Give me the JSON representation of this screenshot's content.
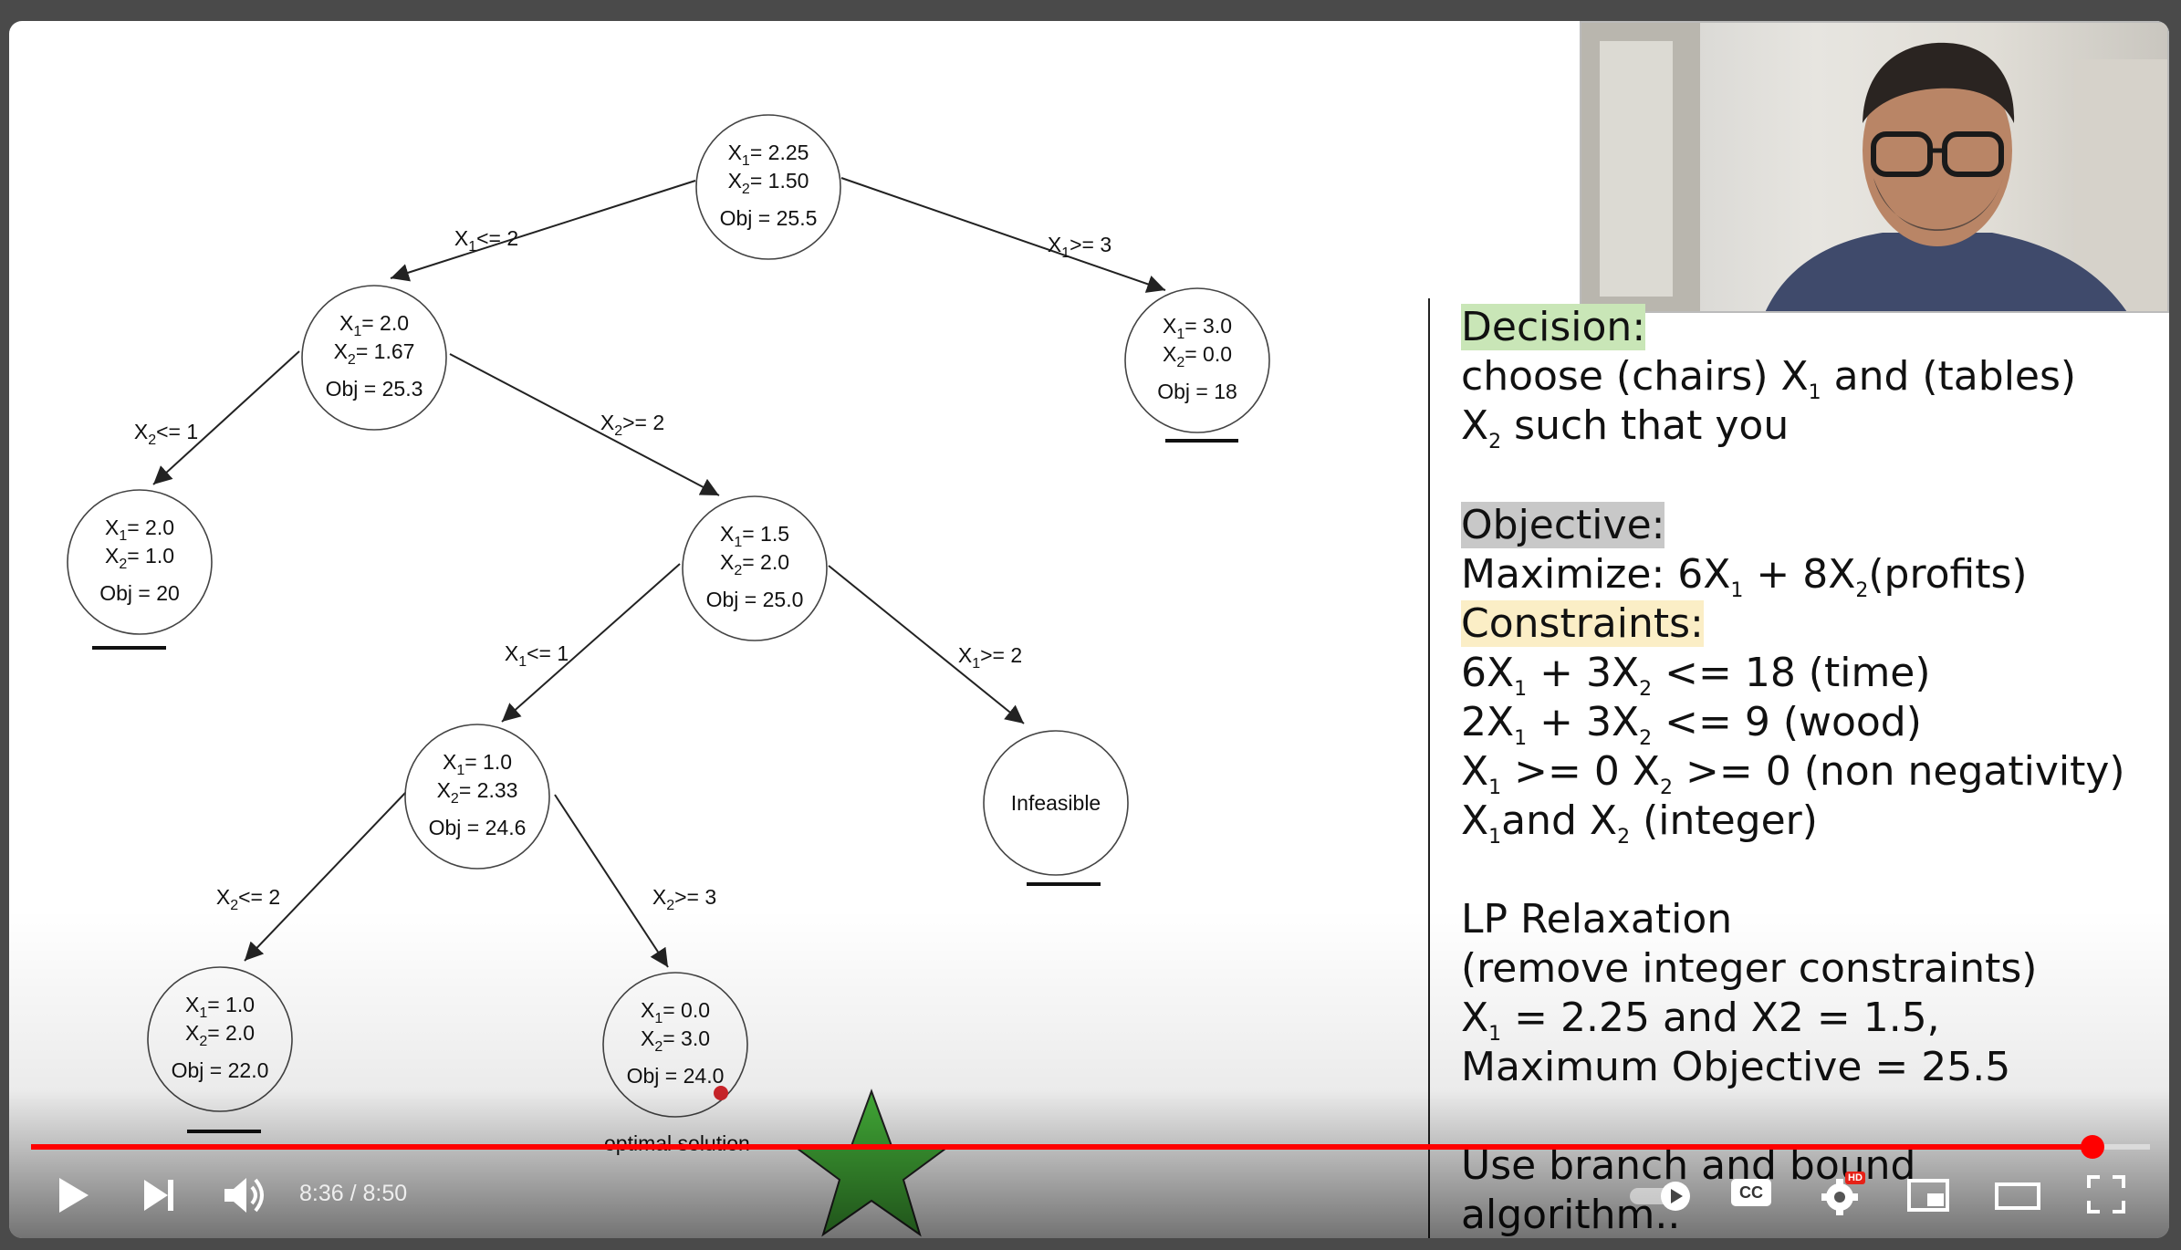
{
  "tree": {
    "nodes": [
      {
        "id": "root",
        "x1": "2.25",
        "x2": "1.50",
        "obj": "Obj = 25.5"
      },
      {
        "id": "n_left",
        "x1": "2.0",
        "x2": "1.67",
        "obj": "Obj = 25.3"
      },
      {
        "id": "n_right",
        "x1": "3.0",
        "x2": "0.0",
        "obj": "Obj = 18"
      },
      {
        "id": "n_ll",
        "x1": "2.0",
        "x2": "1.0",
        "obj": "Obj = 20"
      },
      {
        "id": "n_lr",
        "x1": "1.5",
        "x2": "2.0",
        "obj": "Obj = 25.0"
      },
      {
        "id": "n_lrl",
        "x1": "1.0",
        "x2": "2.33",
        "obj": "Obj = 24.6"
      },
      {
        "id": "n_infeasible",
        "label": "Infeasible"
      },
      {
        "id": "n_lrll",
        "x1": "1.0",
        "x2": "2.0",
        "obj": "Obj = 22.0"
      },
      {
        "id": "n_lrlr",
        "x1": "0.0",
        "x2": "3.0",
        "obj": "Obj = 24.0"
      }
    ],
    "edges": [
      {
        "var": "1",
        "op": "<= 2"
      },
      {
        "var": "1",
        "op": ">= 3"
      },
      {
        "var": "2",
        "op": "<= 1"
      },
      {
        "var": "2",
        "op": ">= 2"
      },
      {
        "var": "1",
        "op": "<= 1"
      },
      {
        "var": "1",
        "op": ">= 2"
      },
      {
        "var": "2",
        "op": "<= 2"
      },
      {
        "var": "2",
        "op": ">= 3"
      }
    ],
    "optimal_label": "optimal solution"
  },
  "panel": {
    "decision_heading": "Decision:",
    "decision_line1_a": "choose (chairs) X",
    "decision_line1_sub": "1",
    "decision_line1_b": " and (tables)",
    "decision_line2_a": "X",
    "decision_line2_sub": "2",
    "decision_line2_b": " such that you",
    "objective_heading": "Objective:",
    "objective_a": "Maximize:  6X",
    "objective_sub1": "1",
    "objective_b": " + 8X",
    "objective_sub2": "2",
    "objective_c": "(profits)",
    "constraints_heading": "Constraints:",
    "c1_a": "6X",
    "c1_s1": "1",
    "c1_b": " + 3X",
    "c1_s2": "2",
    "c1_c": " <= 18 (time)",
    "c2_a": "2X",
    "c2_s1": "1",
    "c2_b": " + 3X",
    "c2_s2": "2",
    "c2_c": " <= 9 (wood)",
    "c3_a": "X",
    "c3_s1": "1",
    "c3_b": " >= 0 X",
    "c3_s2": "2",
    "c3_c": " >= 0 (non negativity)",
    "c4_a": "X",
    "c4_s1": "1",
    "c4_b": "and X",
    "c4_s2": "2",
    "c4_c": " (integer)",
    "lp_heading": "LP Relaxation",
    "lp_line2": "(remove integer constraints)",
    "lp_line3_a": "X",
    "lp_line3_sub": "1",
    "lp_line3_b": " = 2.25 and X2 = 1.5,",
    "lp_line4": "Maximum Objective = 25.5",
    "algo_line1": "Use branch and bound",
    "algo_line2": "algorithm.."
  },
  "player": {
    "current_time": "8:36",
    "duration": "8:50",
    "time_display": "8:36 / 8:50",
    "progress_fraction": 0.973,
    "cc_label": "CC",
    "hd_badge": "HD",
    "accent_color": "#ff0000",
    "icons": [
      "play-icon",
      "next-icon",
      "volume-icon",
      "autoplay-toggle-icon",
      "cc-icon",
      "settings-icon",
      "miniplayer-icon",
      "theater-icon",
      "fullscreen-icon"
    ]
  }
}
